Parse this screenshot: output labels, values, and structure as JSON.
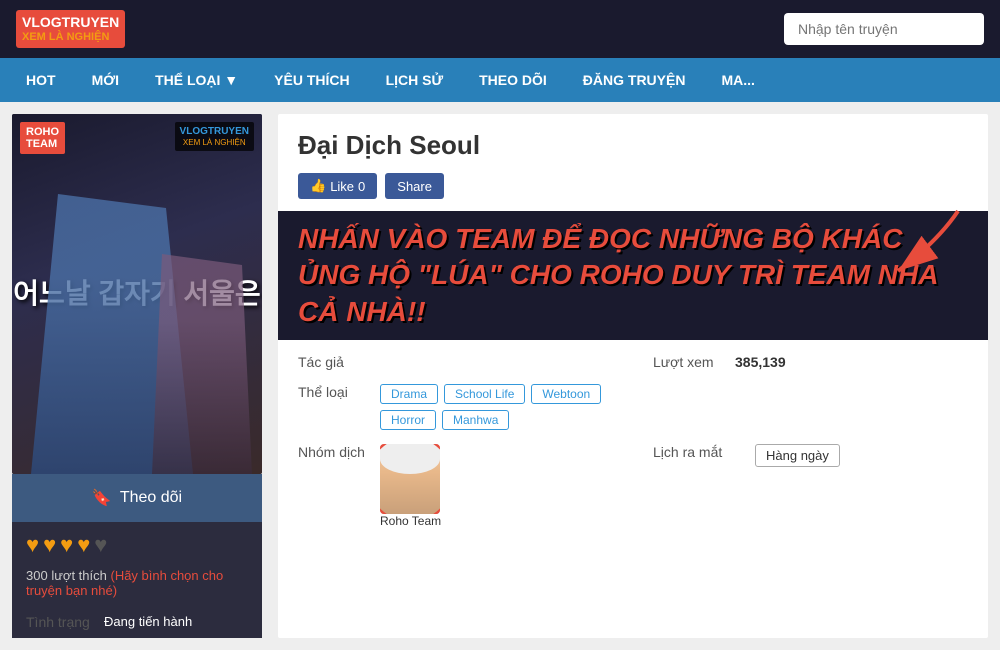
{
  "header": {
    "logo_main": "VLOGTRUYEN",
    "logo_sub": "XEM LÀ NGHIỆN",
    "search_placeholder": "Nhập tên truyện"
  },
  "nav": {
    "items": [
      {
        "label": "HOT"
      },
      {
        "label": "MỚI"
      },
      {
        "label": "THỂ LOẠI ▼"
      },
      {
        "label": "YÊU THÍCH"
      },
      {
        "label": "LỊCH SỬ"
      },
      {
        "label": "THEO DÕI"
      },
      {
        "label": "ĐĂNG TRUYỆN"
      },
      {
        "label": "MA..."
      }
    ]
  },
  "manga": {
    "title": "Đại Dịch Seoul",
    "cover_title": "어느날 갑자기 서울은",
    "cover_team": "VLOGTRUYEN\nXEM LÀ NGHIỆN",
    "like_label": "Like",
    "like_count": "0",
    "share_label": "Share",
    "promo_text": "NHẤN VÀO TEAM ĐỂ ĐỌC NHỮNG BỘ KHÁC ỦNG HỘ \"LÚA\" CHO ROHO DUY TRÌ TEAM NHA CẢ NHÀ!!",
    "info": {
      "author_label": "Tác giả",
      "author_value": "",
      "views_label": "Lượt xem",
      "views_value": "385,139",
      "genre_label": "Thể loại",
      "genres": [
        "Drama",
        "School Life",
        "Webtoon",
        "Horror",
        "Manhwa"
      ],
      "translator_label": "Nhóm dịch",
      "translator_name": "Roho Team",
      "release_label": "Lịch ra mắt",
      "release_value": "Hàng ngày",
      "status_label": "Tình trạng",
      "status_value": "Đang tiến hành"
    },
    "follow_label": "Theo dõi",
    "hearts_filled": 4,
    "hearts_total": 5,
    "likes_count": "300",
    "likes_text": "lượt thích",
    "likes_cta": "(Hãy bình chọn cho truyện bạn nhé)"
  }
}
